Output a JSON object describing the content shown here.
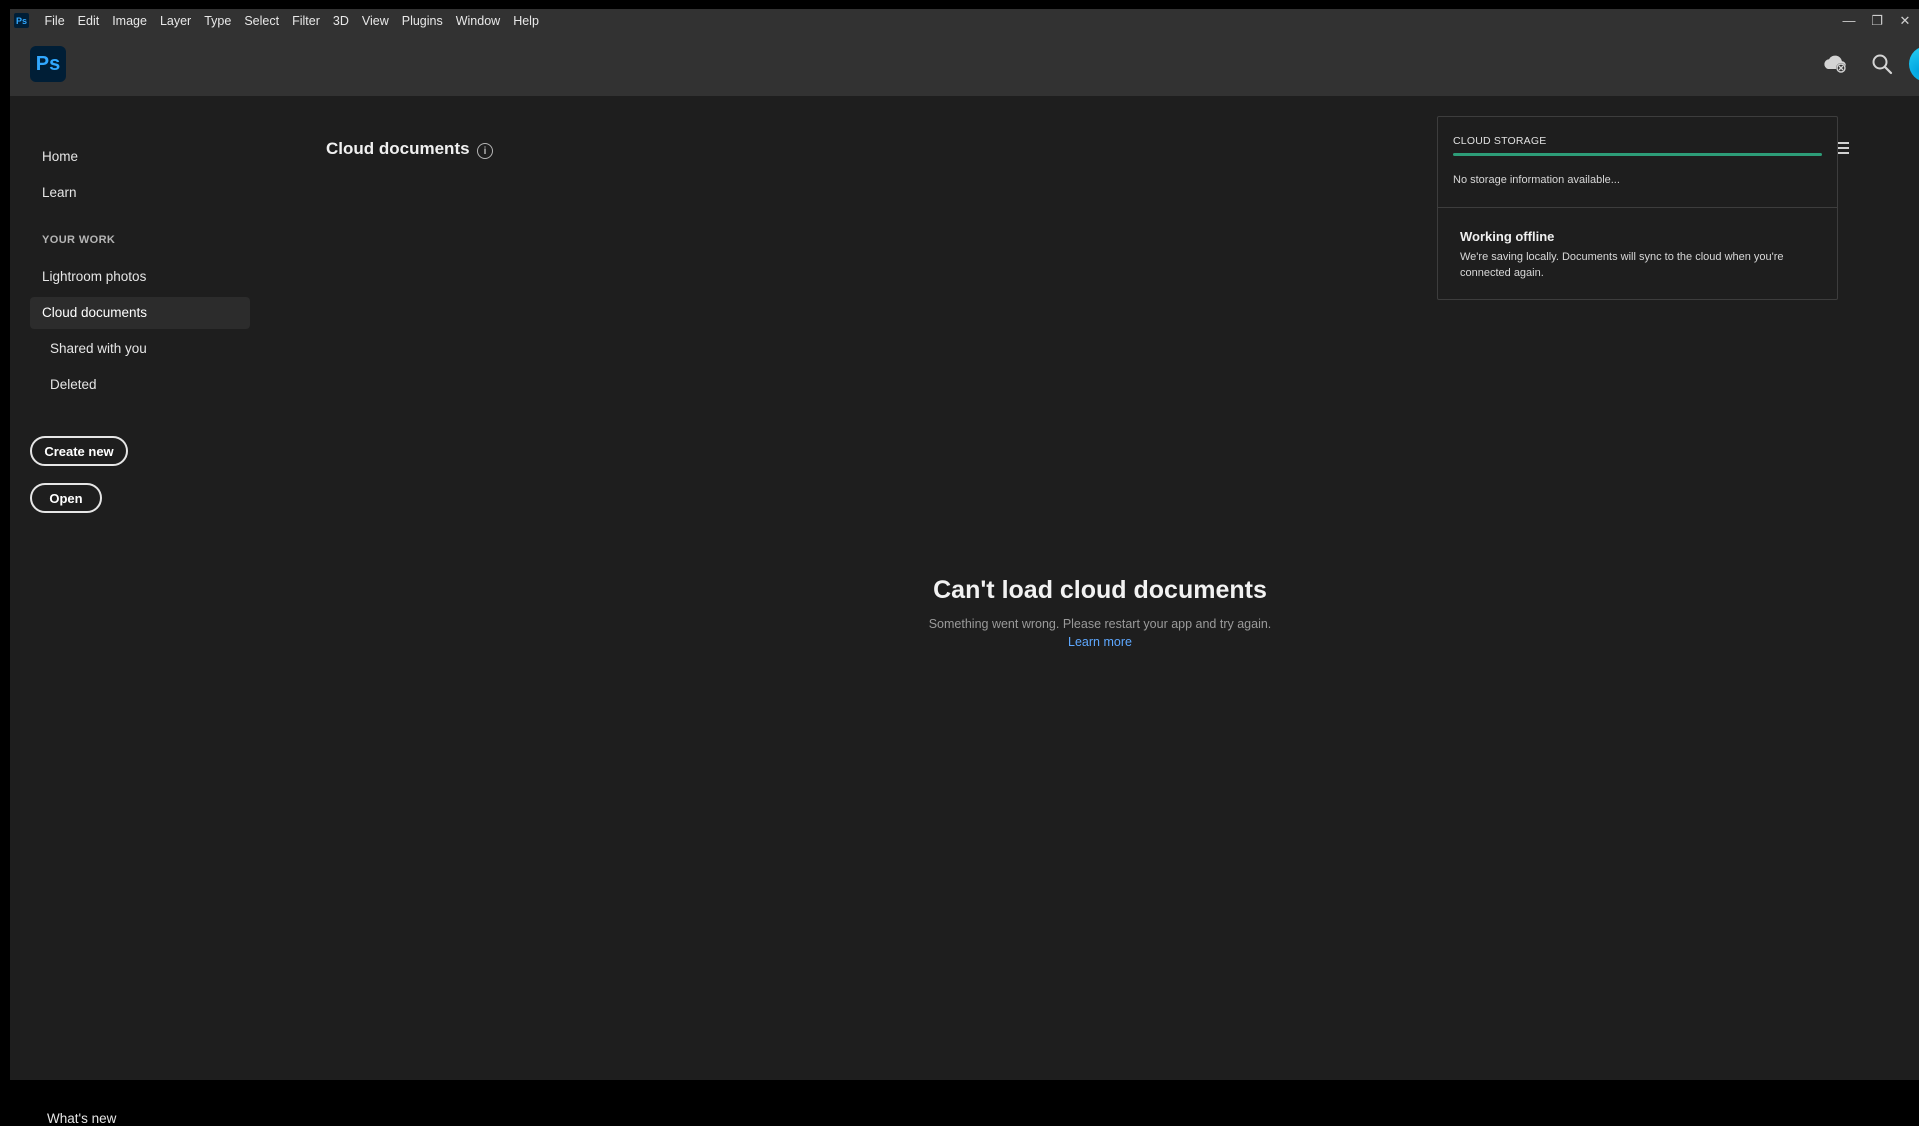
{
  "app": {
    "logo_text": "Ps",
    "mini_logo_text": "Ps"
  },
  "menubar": {
    "items": [
      "File",
      "Edit",
      "Image",
      "Layer",
      "Type",
      "Select",
      "Filter",
      "3D",
      "View",
      "Plugins",
      "Window",
      "Help"
    ],
    "window_controls": {
      "minimize": "—",
      "restore": "❐",
      "close": "✕"
    }
  },
  "header": {
    "icons": [
      "cloud-offline-icon",
      "search-icon",
      "avatar"
    ]
  },
  "sidebar": {
    "home": "Home",
    "learn": "Learn",
    "section_label": "YOUR WORK",
    "lightroom": "Lightroom photos",
    "cloud_documents": "Cloud documents",
    "shared": "Shared with you",
    "deleted": "Deleted",
    "create_new": "Create new",
    "open": "Open",
    "whats_new": "What's new"
  },
  "main": {
    "title": "Cloud documents",
    "info_glyph": "i",
    "empty_title": "Can't load cloud documents",
    "empty_sub": "Something went wrong. Please restart your app and try again.",
    "empty_link": "Learn more"
  },
  "popover": {
    "storage_label": "CLOUD STORAGE",
    "storage_info": "No storage information available...",
    "heading": "Working offline",
    "text": "We're saving locally. Documents will sync to the cloud when you're connected again."
  },
  "colors": {
    "accent": "#31a8ff",
    "storage_bar": "#2d9d78",
    "link": "#5ea8ff"
  }
}
